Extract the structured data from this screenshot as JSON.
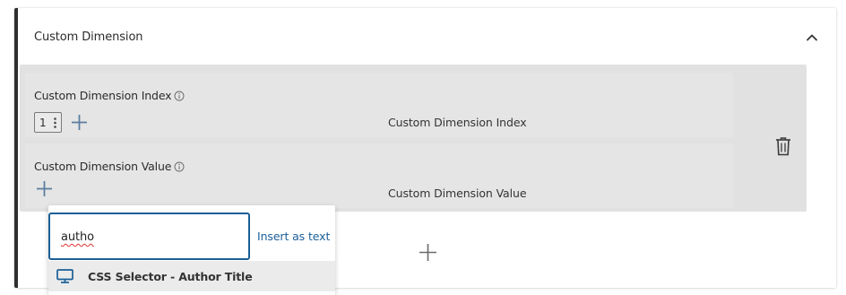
{
  "section": {
    "title": "Custom Dimension",
    "collapse_icon": "chevron-up-icon"
  },
  "rows": [
    {
      "label": "Custom Dimension Index",
      "hint": "Custom Dimension Index",
      "value": "1"
    },
    {
      "label": "Custom Dimension Value",
      "hint": "Custom Dimension Value"
    }
  ],
  "popup": {
    "search_value": "autho",
    "insert_as_text": "Insert as text",
    "suggestions": [
      {
        "label": "CSS Selector - Author Title",
        "icon": "monitor-icon"
      }
    ]
  },
  "colors": {
    "accent": "#1b5f96",
    "link": "#1a5f9b",
    "group_bg": "#e1e1e1",
    "card_border": "#2f2f2f"
  }
}
